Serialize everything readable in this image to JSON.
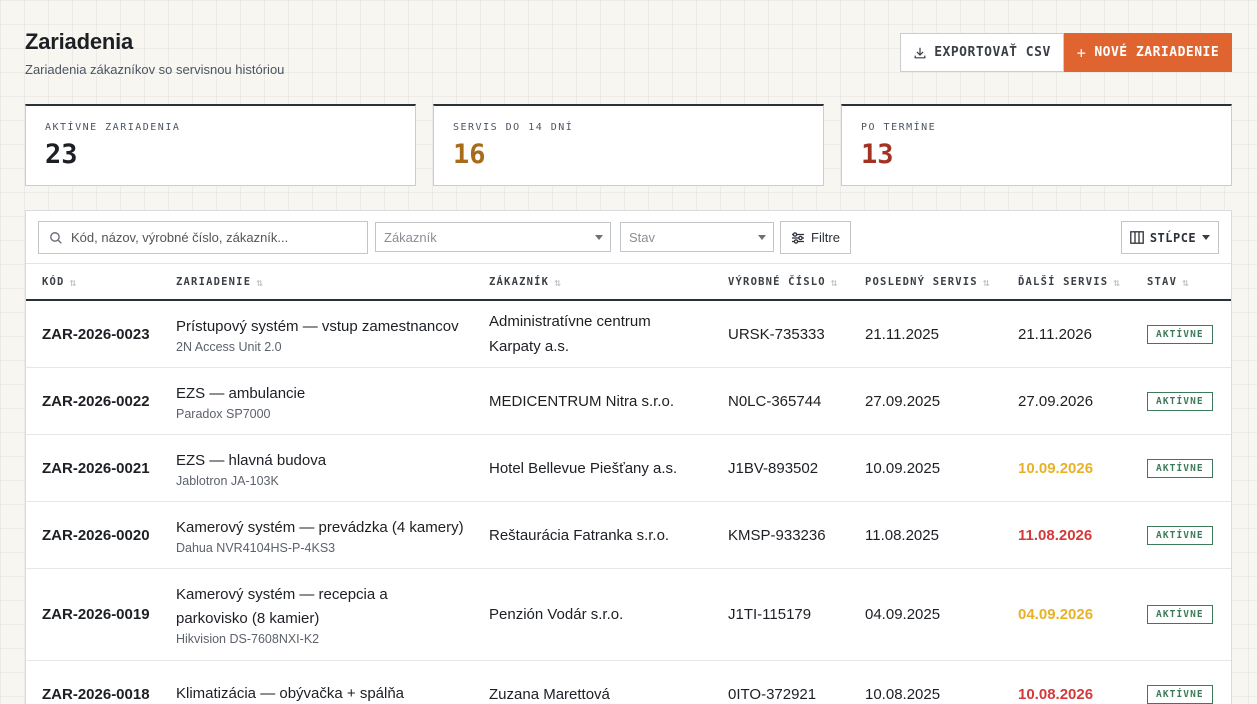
{
  "header": {
    "title": "Zariadenia",
    "subtitle": "Zariadenia zákazníkov so servisnou históriou",
    "export_label": "EXPORTOVAŤ CSV",
    "new_label": "NOVÉ ZARIADENIE",
    "new_plus": "+"
  },
  "stats": [
    {
      "label": "AKTÍVNE ZARIADENIA",
      "value": "23",
      "color": "#1c1f24"
    },
    {
      "label": "SERVIS DO 14 DNÍ",
      "value": "16",
      "color": "#a86b1c"
    },
    {
      "label": "PO TERMÍNE",
      "value": "13",
      "color": "#a33223"
    }
  ],
  "toolbar": {
    "search_placeholder": "Kód, názov, výrobné číslo, zákazník...",
    "customer_placeholder": "Zákazník",
    "status_placeholder": "Stav",
    "filter_label": "Filtre",
    "columns_label": "STĹPCE"
  },
  "table": {
    "columns": [
      "KÓD",
      "ZARIADENIE",
      "ZÁKAZNÍK",
      "VÝROBNÉ ČÍSLO",
      "POSLEDNÝ SERVIS",
      "ĎALŠÍ SERVIS",
      "STAV"
    ],
    "sort_icon": "⇅",
    "rows": [
      {
        "code": "ZAR-2026-0023",
        "name_lines": [
          "Prístupový systém — vstup zamestnancov"
        ],
        "model": "2N Access Unit 2.0",
        "customer_lines": [
          "Administratívne centrum",
          "Karpaty a.s."
        ],
        "serial": "URSK-735333",
        "last": "21.11.2025",
        "next": "21.11.2026",
        "next_color": "#1c1f24",
        "next_bold": false,
        "status": "AKTÍVNE"
      },
      {
        "code": "ZAR-2026-0022",
        "name_lines": [
          "EZS — ambulancie"
        ],
        "model": "Paradox SP7000",
        "customer_lines": [
          "MEDICENTRUM Nitra s.r.o."
        ],
        "serial": "N0LC-365744",
        "last": "27.09.2025",
        "next": "27.09.2026",
        "next_color": "#1c1f24",
        "next_bold": false,
        "status": "AKTÍVNE"
      },
      {
        "code": "ZAR-2026-0021",
        "name_lines": [
          "EZS — hlavná budova"
        ],
        "model": "Jablotron JA-103K",
        "customer_lines": [
          "Hotel Bellevue Piešťany a.s."
        ],
        "serial": "J1BV-893502",
        "last": "10.09.2025",
        "next": "10.09.2026",
        "next_color": "#e8b228",
        "next_bold": true,
        "status": "AKTÍVNE"
      },
      {
        "code": "ZAR-2026-0020",
        "name_lines": [
          "Kamerový systém — prevádzka (4 kamery)"
        ],
        "model": "Dahua NVR4104HS-P-4KS3",
        "customer_lines": [
          "Reštaurácia Fatranka s.r.o."
        ],
        "serial": "KMSP-933236",
        "last": "11.08.2025",
        "next": "11.08.2026",
        "next_color": "#d43a3a",
        "next_bold": true,
        "status": "AKTÍVNE"
      },
      {
        "code": "ZAR-2026-0019",
        "name_lines": [
          "Kamerový systém — recepcia a",
          "parkovisko (8 kamier)"
        ],
        "model": "Hikvision DS-7608NXI-K2",
        "customer_lines": [
          "Penzión Vodár s.r.o."
        ],
        "serial": "J1TI-115179",
        "last": "04.09.2025",
        "next": "04.09.2026",
        "next_color": "#e8b228",
        "next_bold": true,
        "status": "AKTÍVNE"
      },
      {
        "code": "ZAR-2026-0018",
        "name_lines": [
          "Klimatizácia — obývačka + spálňa"
        ],
        "model": "",
        "customer_lines": [
          "Zuzana Marettová"
        ],
        "serial": "0ITO-372921",
        "last": "10.08.2025",
        "next": "10.08.2026",
        "next_color": "#d43a3a",
        "next_bold": true,
        "status": "AKTÍVNE"
      }
    ]
  }
}
